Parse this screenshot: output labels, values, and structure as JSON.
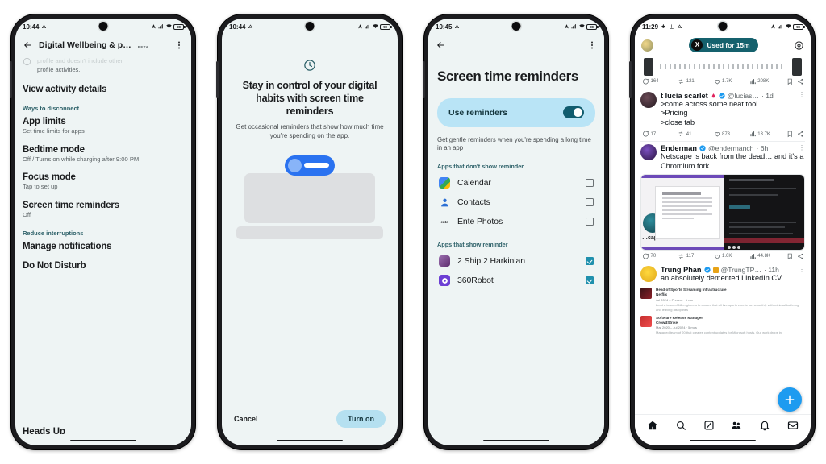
{
  "screens": [
    {
      "id": "digital-wellbeing-settings",
      "statusbar": {
        "time": "10:44",
        "battery_label": "90"
      },
      "appbar": {
        "title": "Digital Wellbeing & p…",
        "badge": "BETA"
      },
      "clipped_text_top": "profile and doesn't include other",
      "clipped_text_second": "profile activities.",
      "items": [
        {
          "kind": "item",
          "title": "View activity details",
          "subtitle": ""
        },
        {
          "kind": "section",
          "title": "Ways to disconnect"
        },
        {
          "kind": "item",
          "title": "App limits",
          "subtitle": "Set time limits for apps"
        },
        {
          "kind": "item",
          "title": "Bedtime mode",
          "subtitle": "Off / Turns on while charging after 9:00 PM"
        },
        {
          "kind": "item",
          "title": "Focus mode",
          "subtitle": "Tap to set up"
        },
        {
          "kind": "item",
          "title": "Screen time reminders",
          "subtitle": "Off"
        },
        {
          "kind": "section",
          "title": "Reduce interruptions"
        },
        {
          "kind": "item",
          "title": "Manage notifications",
          "subtitle": ""
        },
        {
          "kind": "item",
          "title": "Do Not Disturb",
          "subtitle": ""
        }
      ],
      "cut_off_item": "Heads Up"
    },
    {
      "id": "screen-time-reminders-intro",
      "statusbar": {
        "time": "10:44",
        "battery_label": "90"
      },
      "icon": "clock-icon",
      "title": "Stay in control of your digital habits with screen time reminders",
      "subtitle": "Get occasional reminders that show how much time you're spending on the app.",
      "cancel_label": "Cancel",
      "confirm_label": "Turn on"
    },
    {
      "id": "screen-time-reminders",
      "statusbar": {
        "time": "10:45",
        "battery_label": "90"
      },
      "heading": "Screen time reminders",
      "toggle": {
        "label": "Use reminders",
        "on": true
      },
      "description": "Get gentle reminders when you're spending a long time in an app",
      "section_off": "Apps that don't show reminder",
      "section_on": "Apps that show reminder",
      "apps_off": [
        {
          "name": "Calendar",
          "icon": "calendar-app-icon",
          "checked": false
        },
        {
          "name": "Contacts",
          "icon": "contacts-app-icon",
          "checked": false
        },
        {
          "name": "Ente Photos",
          "icon": "ente-photos-app-icon",
          "checked": false
        }
      ],
      "apps_on": [
        {
          "name": "2 Ship 2 Harkinian",
          "icon": "ship-app-icon",
          "checked": true
        },
        {
          "name": "360Robot",
          "icon": "robot-app-icon",
          "checked": true
        }
      ]
    },
    {
      "id": "social-feed-with-reminder",
      "statusbar": {
        "time": "11:29",
        "battery_label": "90"
      },
      "reminder_pill": {
        "brand": "X",
        "text": "Used for 15m"
      },
      "partial_tweet_actions": {
        "replies": "164",
        "reposts": "121",
        "likes": "1.7K",
        "views": "208K"
      },
      "tweets": [
        {
          "display_name": "t lucia scarlet",
          "handle": "@lucias…",
          "age": "1d",
          "text": ">come across some neat tool\n>Pricing\n>close tab",
          "actions": {
            "replies": "17",
            "reposts": "41",
            "likes": "873",
            "views": "13.7K"
          }
        },
        {
          "display_name": "Enderman",
          "handle": "@endermanch",
          "age": "6h",
          "text": "Netscape is back from the dead… and it's a Chromium fork.",
          "media_caption": "…cape",
          "media_window_title": "Welcome to Netscape Setup",
          "actions": {
            "replies": "70",
            "reposts": "117",
            "likes": "1.6K",
            "views": "44.8K"
          }
        },
        {
          "display_name": "Trung Phan",
          "handle": "@TrungTP…",
          "age": "11h",
          "text": "an absolutely demented LinkedIn CV",
          "cv_entries": [
            {
              "role": "Head of Sports Streaming Infrastructure",
              "company": "Netflix",
              "dates": "Jul 2024 – Present  ·  1 mo",
              "body": "Lead a team of 18 engineers to ensure that all live sports events run smoothly with minimal buffering and leaving disciplines"
            },
            {
              "role": "Software Release Manager",
              "company": "CrowdStrike",
              "dates": "Mar 2020 – Jul 2024  ·  5 mos",
              "body": "Managed team of 20 that creates content updates for Microsoft hosts. Our work drops in"
            }
          ]
        }
      ],
      "nav_items": [
        {
          "name": "home-nav-icon"
        },
        {
          "name": "search-nav-icon"
        },
        {
          "name": "grok-nav-icon"
        },
        {
          "name": "communities-nav-icon"
        },
        {
          "name": "notifications-nav-icon"
        },
        {
          "name": "messages-nav-icon"
        }
      ],
      "fab": {
        "name": "compose-fab",
        "icon": "plus-icon"
      }
    }
  ],
  "colors": {
    "settings_bg": "#eef4f4",
    "accent_teal": "#2c6068",
    "toggle_card": "#b9e4f6",
    "toggle_on": "#115c6e",
    "checkbox_on": "#1f90ad",
    "confirm_button": "#b5e0f0",
    "pill_bg": "#15616d",
    "fab_blue": "#1d9bf0",
    "verified_blue": "#1d9bf0"
  }
}
